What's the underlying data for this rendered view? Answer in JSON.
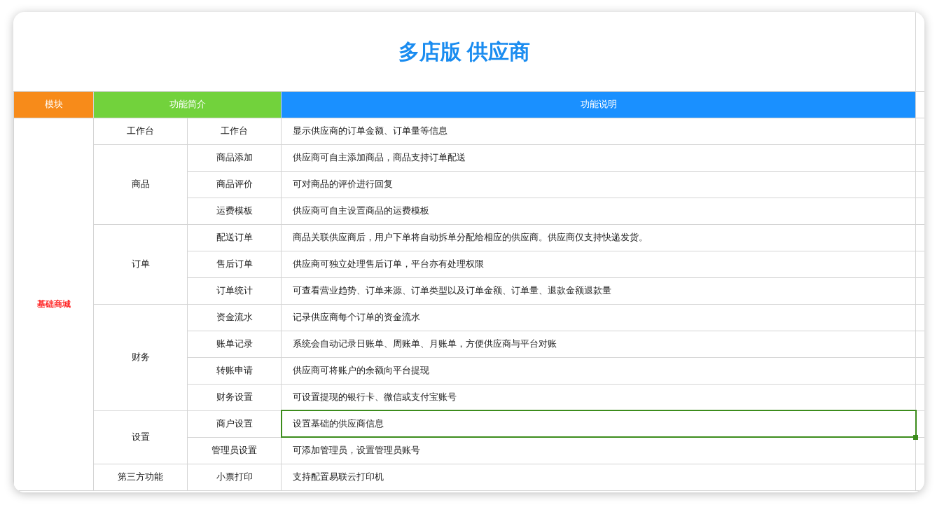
{
  "title": "多店版 供应商",
  "header": {
    "module": "模块",
    "intro": "功能简介",
    "description": "功能说明"
  },
  "modules": [
    {
      "name": "基础商城",
      "categories": [
        {
          "name": "工作台",
          "features": [
            {
              "name": "工作台",
              "description": "显示供应商的订单金额、订单量等信息",
              "selected": false
            }
          ]
        },
        {
          "name": "商品",
          "features": [
            {
              "name": "商品添加",
              "description": "供应商可自主添加商品，商品支持订单配送",
              "selected": false
            },
            {
              "name": "商品评价",
              "description": "可对商品的评价进行回复",
              "selected": false
            },
            {
              "name": "运费模板",
              "description": "供应商可自主设置商品的运费模板",
              "selected": false
            }
          ]
        },
        {
          "name": "订单",
          "features": [
            {
              "name": "配送订单",
              "description": "商品关联供应商后，用户下单将自动拆单分配给相应的供应商。供应商仅支持快递发货。",
              "selected": false
            },
            {
              "name": "售后订单",
              "description": "供应商可独立处理售后订单，平台亦有处理权限",
              "selected": false
            },
            {
              "name": "订单统计",
              "description": "可查看营业趋势、订单来源、订单类型以及订单金额、订单量、退款金额退款量",
              "selected": false
            }
          ]
        },
        {
          "name": "财务",
          "features": [
            {
              "name": "资金流水",
              "description": "记录供应商每个订单的资金流水",
              "selected": false
            },
            {
              "name": "账单记录",
              "description": "系统会自动记录日账单、周账单、月账单，方便供应商与平台对账",
              "selected": false
            },
            {
              "name": "转账申请",
              "description": "供应商可将账户的余额向平台提现",
              "selected": false
            },
            {
              "name": "财务设置",
              "description": "可设置提现的银行卡、微信或支付宝账号",
              "selected": false
            }
          ]
        },
        {
          "name": "设置",
          "features": [
            {
              "name": "商户设置",
              "description": "设置基础的供应商信息",
              "selected": true
            },
            {
              "name": "管理员设置",
              "description": "可添加管理员，设置管理员账号",
              "selected": false
            }
          ]
        },
        {
          "name": "第三方功能",
          "features": [
            {
              "name": "小票打印",
              "description": "支持配置易联云打印机",
              "selected": false
            }
          ]
        }
      ]
    }
  ]
}
